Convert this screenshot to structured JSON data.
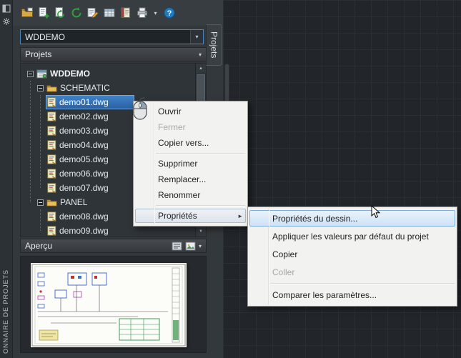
{
  "window": {
    "side_title": "ONNAIRE DE PROJETS",
    "side_tab": "Projets"
  },
  "toolbar": {
    "icons": [
      {
        "name": "project-manager-icon"
      },
      {
        "name": "new-drawing-icon"
      },
      {
        "name": "refresh-drawing-icon"
      },
      {
        "name": "update-project-icon"
      },
      {
        "name": "project-properties-icon"
      },
      {
        "name": "drawing-list-icon"
      },
      {
        "name": "catalog-icon"
      },
      {
        "name": "plot-icon"
      },
      {
        "name": "toolbar-overflow-icon",
        "glyph": "▾"
      },
      {
        "name": "help-icon"
      }
    ]
  },
  "project_selector": {
    "value": "WDDEMO"
  },
  "sections": {
    "projects": "Projets",
    "preview": "Aperçu"
  },
  "tree": {
    "nodes": [
      {
        "label": "WDDEMO",
        "type": "project",
        "level": 0,
        "expanded": true
      },
      {
        "label": "SCHEMATIC",
        "type": "folder",
        "level": 1,
        "expanded": true
      },
      {
        "label": "demo01.dwg",
        "type": "drawing",
        "level": 2,
        "selected": true
      },
      {
        "label": "demo02.dwg",
        "type": "drawing",
        "level": 2
      },
      {
        "label": "demo03.dwg",
        "type": "drawing",
        "level": 2
      },
      {
        "label": "demo04.dwg",
        "type": "drawing",
        "level": 2
      },
      {
        "label": "demo05.dwg",
        "type": "drawing",
        "level": 2
      },
      {
        "label": "demo06.dwg",
        "type": "drawing",
        "level": 2
      },
      {
        "label": "demo07.dwg",
        "type": "drawing",
        "level": 2
      },
      {
        "label": "PANEL",
        "type": "folder",
        "level": 1,
        "expanded": true
      },
      {
        "label": "demo08.dwg",
        "type": "drawing",
        "level": 2
      },
      {
        "label": "demo09.dwg",
        "type": "drawing",
        "level": 2
      }
    ]
  },
  "context_menu": {
    "items": [
      {
        "label": "Ouvrir"
      },
      {
        "label": "Fermer",
        "disabled": true
      },
      {
        "label": "Copier vers..."
      },
      {
        "separator": true
      },
      {
        "label": "Supprimer"
      },
      {
        "label": "Remplacer..."
      },
      {
        "label": "Renommer"
      },
      {
        "separator": true
      },
      {
        "label": "Propriétés",
        "submenu": true,
        "highlighted": "parent"
      }
    ]
  },
  "submenu": {
    "items": [
      {
        "label": "Propriétés du dessin...",
        "highlighted": "hover"
      },
      {
        "label": "Appliquer les valeurs par défaut du projet"
      },
      {
        "label": "Copier"
      },
      {
        "label": "Coller",
        "disabled": true
      },
      {
        "separator": true
      },
      {
        "label": "Comparer les paramètres..."
      }
    ]
  },
  "colors": {
    "selection_blue": "#2e6db8",
    "menu_highlight": "#cde2f6",
    "accent_green": "#2fa13a",
    "canvas_background": "#22262a"
  }
}
